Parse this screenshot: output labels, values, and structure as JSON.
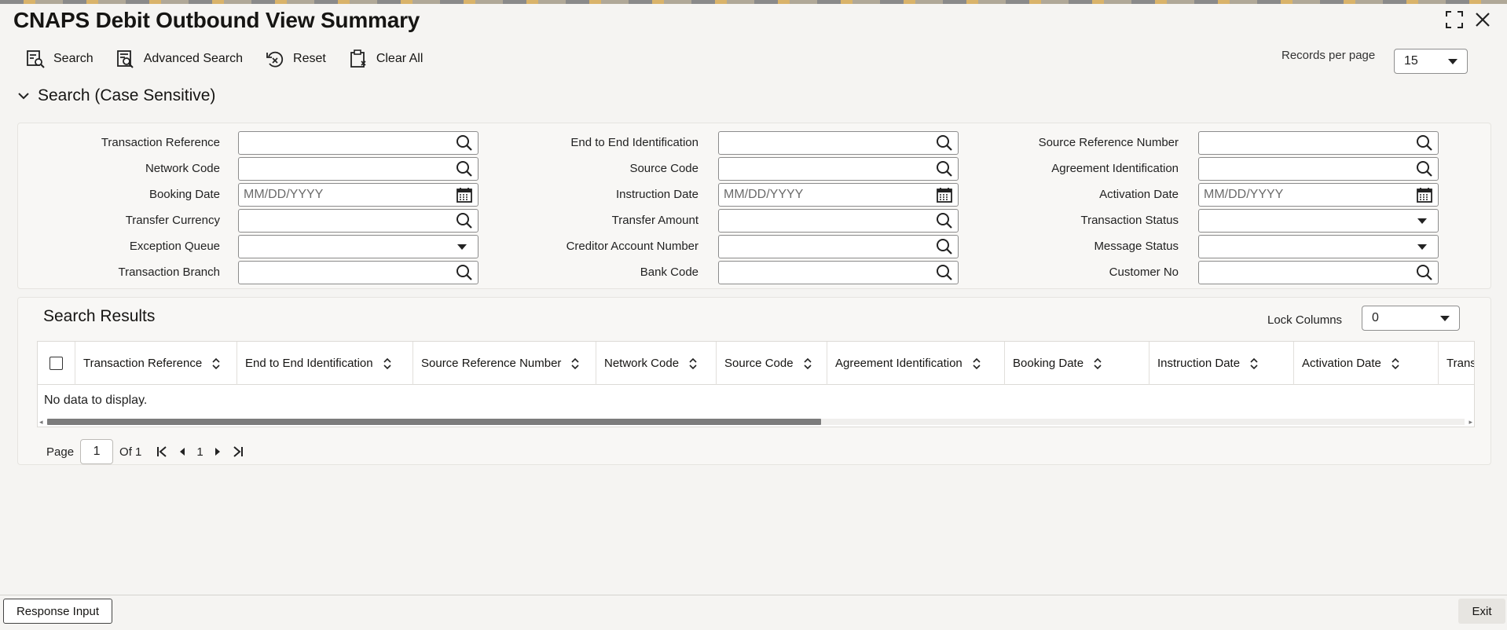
{
  "window": {
    "title": "CNAPS Debit Outbound View Summary"
  },
  "toolbar": {
    "search": "Search",
    "advanced_search": "Advanced Search",
    "reset": "Reset",
    "clear_all": "Clear All"
  },
  "records_per_page": {
    "label": "Records per page",
    "value": "15"
  },
  "search_section": {
    "title": "Search (Case Sensitive)"
  },
  "fields": {
    "transaction_reference": {
      "label": "Transaction Reference",
      "value": ""
    },
    "end_to_end_identification": {
      "label": "End to End Identification",
      "value": ""
    },
    "source_reference_number": {
      "label": "Source Reference Number",
      "value": ""
    },
    "network_code": {
      "label": "Network Code",
      "value": ""
    },
    "source_code": {
      "label": "Source Code",
      "value": ""
    },
    "agreement_identification": {
      "label": "Agreement Identification",
      "value": ""
    },
    "booking_date": {
      "label": "Booking Date",
      "placeholder": "MM/DD/YYYY"
    },
    "instruction_date": {
      "label": "Instruction Date",
      "placeholder": "MM/DD/YYYY"
    },
    "activation_date": {
      "label": "Activation Date",
      "placeholder": "MM/DD/YYYY"
    },
    "transfer_currency": {
      "label": "Transfer Currency",
      "value": ""
    },
    "transfer_amount": {
      "label": "Transfer Amount",
      "value": ""
    },
    "transaction_status": {
      "label": "Transaction Status",
      "value": ""
    },
    "exception_queue": {
      "label": "Exception Queue",
      "value": ""
    },
    "creditor_account_number": {
      "label": "Creditor Account Number",
      "value": ""
    },
    "message_status": {
      "label": "Message Status",
      "value": ""
    },
    "transaction_branch": {
      "label": "Transaction Branch",
      "value": ""
    },
    "bank_code": {
      "label": "Bank Code",
      "value": ""
    },
    "customer_no": {
      "label": "Customer No",
      "value": ""
    }
  },
  "results": {
    "title": "Search Results",
    "lock_columns": {
      "label": "Lock Columns",
      "value": "0"
    },
    "columns": [
      "Transaction Reference",
      "End to End Identification",
      "Source Reference Number",
      "Network Code",
      "Source Code",
      "Agreement Identification",
      "Booking Date",
      "Instruction Date",
      "Activation Date",
      "Trans"
    ],
    "empty_message": "No data to display."
  },
  "pagination": {
    "page_label": "Page",
    "current_page": "1",
    "of_label": "Of 1",
    "page_number": "1"
  },
  "footer": {
    "response_input": "Response Input",
    "exit": "Exit"
  }
}
